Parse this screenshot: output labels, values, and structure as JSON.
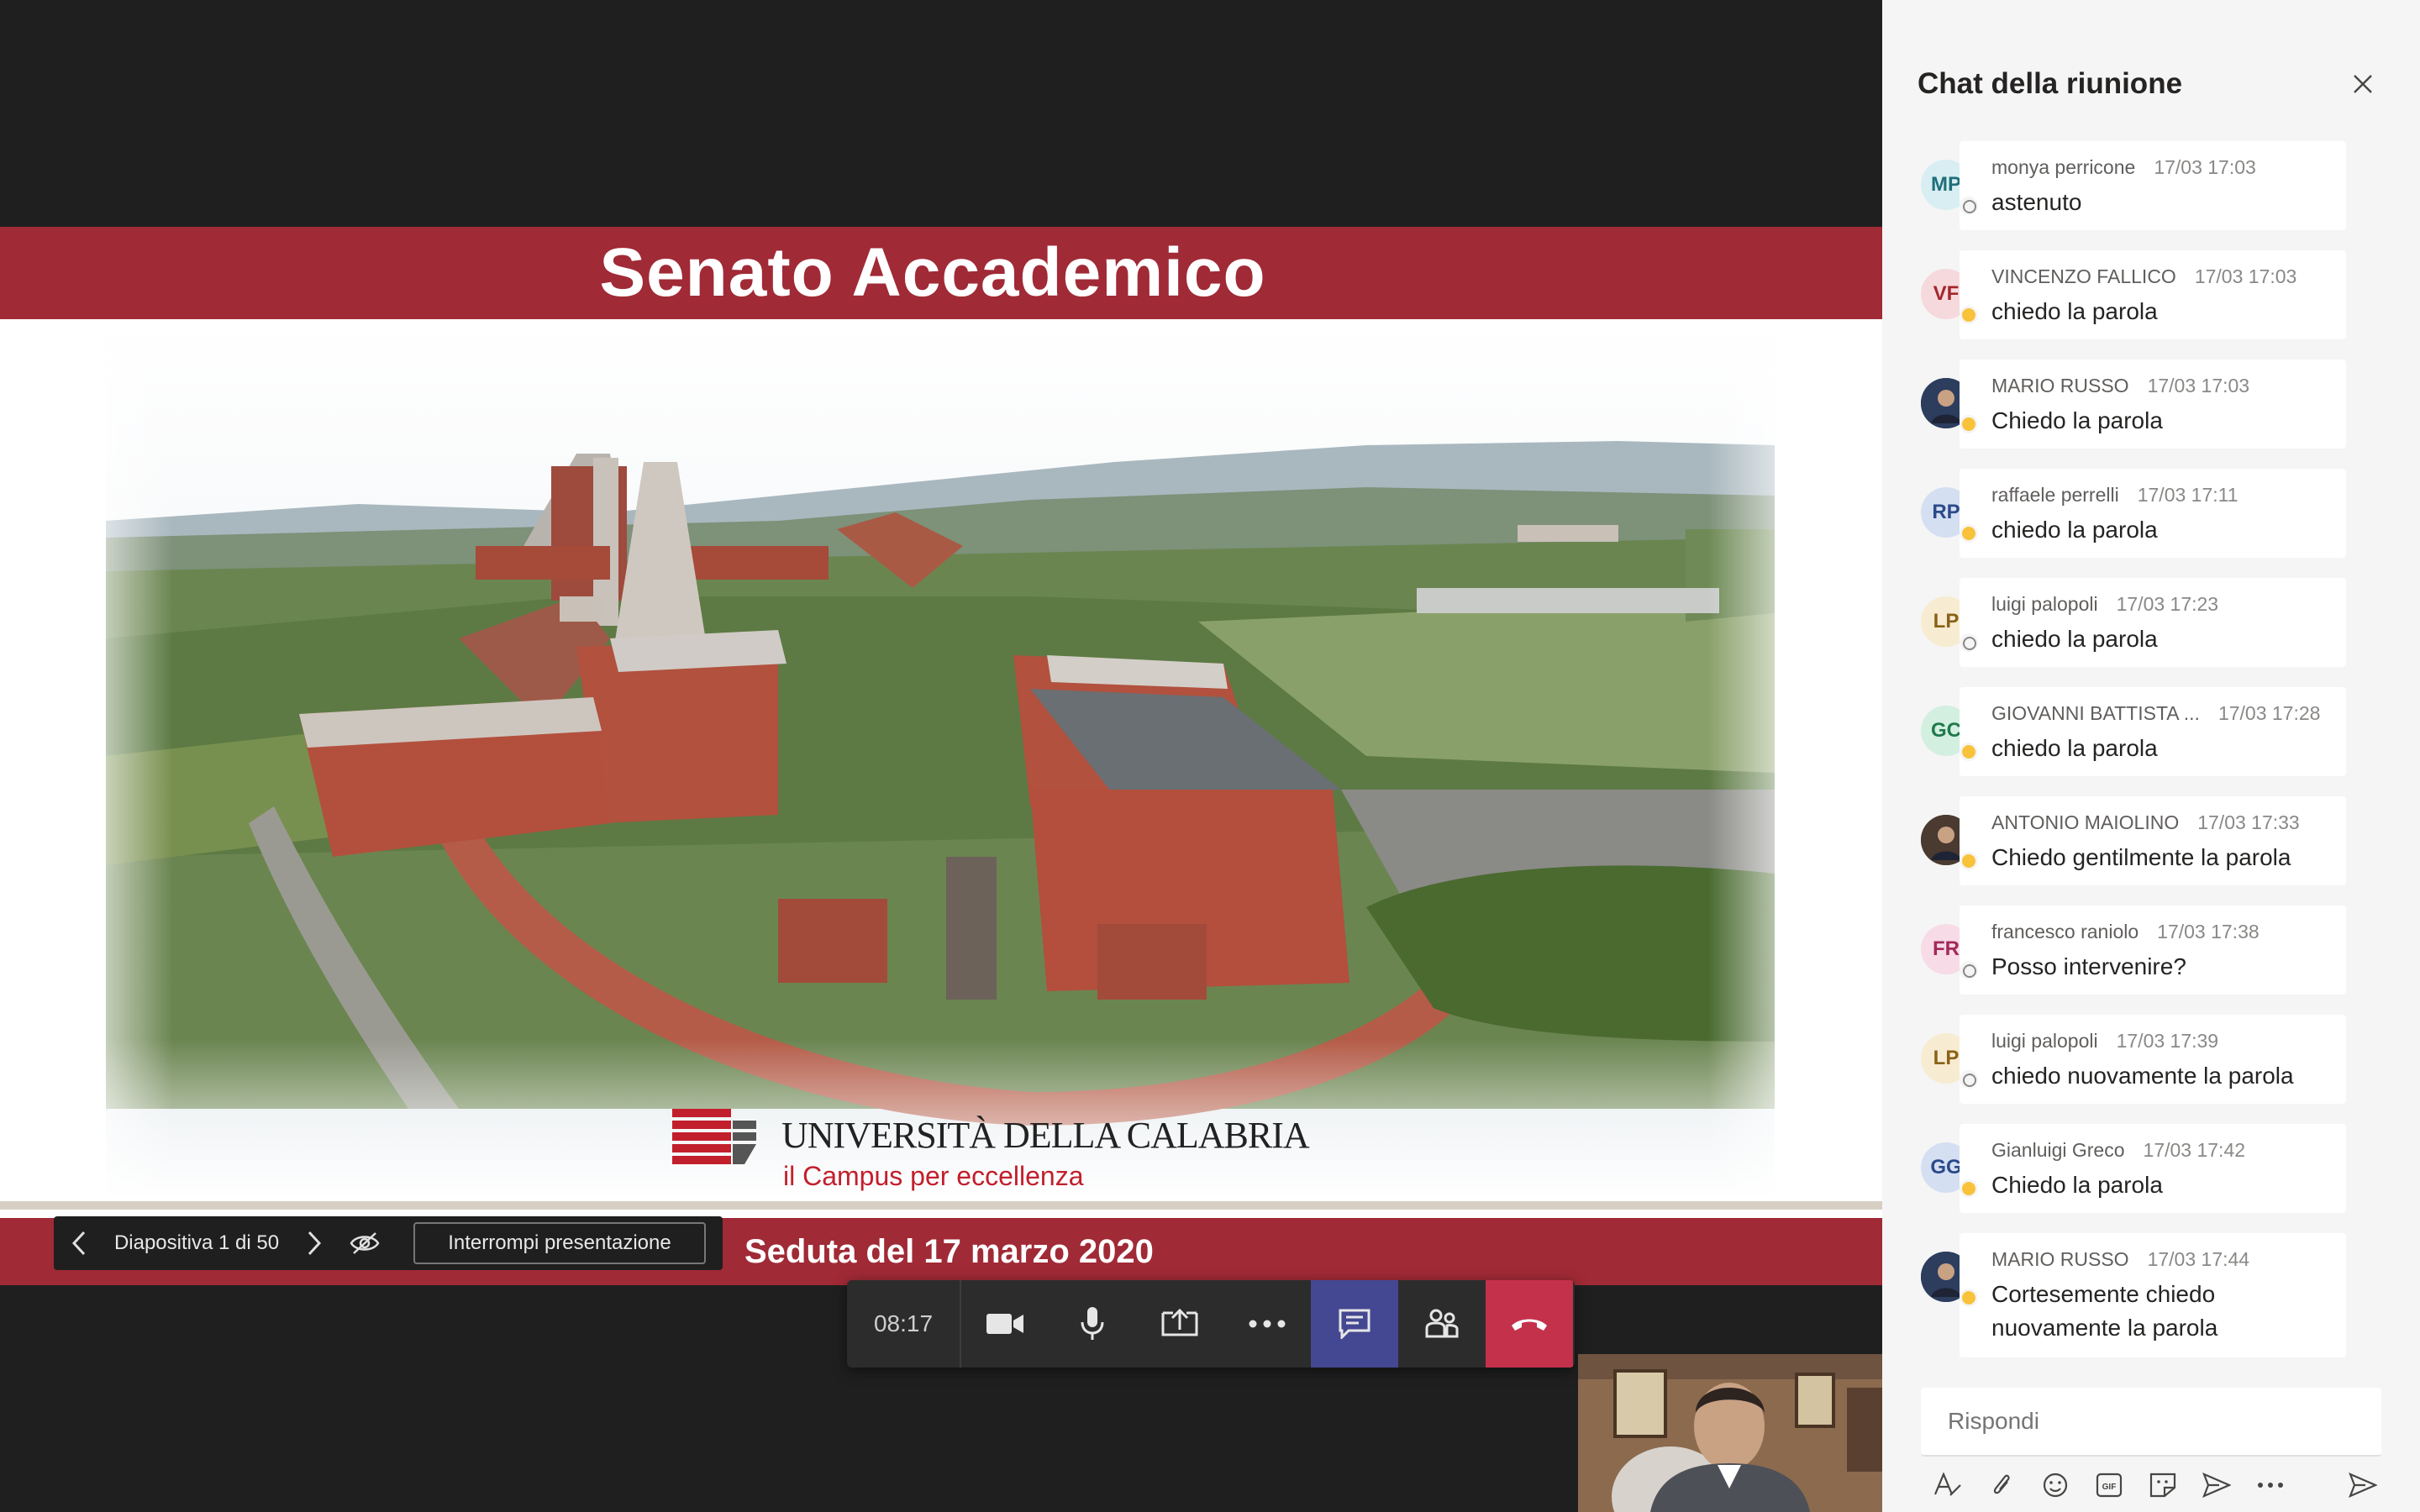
{
  "slide": {
    "title": "Senato Accademico",
    "logo_name": "UNIVERSITÀ DELLA CALABRIA",
    "logo_tagline": "il Campus per eccellenza",
    "subtitle": "Seduta del 17 marzo 2020"
  },
  "presenter_controls": {
    "slide_counter": "Diapositiva 1 di 50",
    "stop_label": "Interrompi presentazione"
  },
  "toolbar": {
    "timer": "08:17"
  },
  "chat": {
    "title": "Chat della riunione",
    "messages": [
      {
        "initials": "MP",
        "author": "monya perricone",
        "time": "17/03 17:03",
        "text": "astenuto",
        "avatar_bg": "#d8eef2",
        "avatar_fg": "#1e6e7a",
        "presence": "offline"
      },
      {
        "initials": "VF",
        "author": "VINCENZO FALLICO",
        "time": "17/03 17:03",
        "text": "chiedo la parola",
        "avatar_bg": "#f6d9dc",
        "avatar_fg": "#a4262c",
        "presence": "away"
      },
      {
        "initials": "",
        "author": "MARIO RUSSO",
        "time": "17/03 17:03",
        "text": "Chiedo la parola",
        "avatar_bg": "#2c3d5e",
        "avatar_fg": "#ffffff",
        "presence": "away"
      },
      {
        "initials": "RP",
        "author": "raffaele perrelli",
        "time": "17/03 17:11",
        "text": "chiedo la parola",
        "avatar_bg": "#d5dff2",
        "avatar_fg": "#2a4a8a",
        "presence": "away"
      },
      {
        "initials": "LP",
        "author": "luigi palopoli",
        "time": "17/03 17:23",
        "text": "chiedo la parola",
        "avatar_bg": "#f7ecd2",
        "avatar_fg": "#8a6116",
        "presence": "offline"
      },
      {
        "initials": "GC",
        "author": "GIOVANNI BATTISTA ...",
        "time": "17/03 17:28",
        "text": "chiedo la parola",
        "avatar_bg": "#d3efe0",
        "avatar_fg": "#1f7a4b",
        "presence": "away"
      },
      {
        "initials": "",
        "author": "ANTONIO MAIOLINO",
        "time": "17/03 17:33",
        "text": "Chiedo gentilmente la parola",
        "avatar_bg": "#4a3a30",
        "avatar_fg": "#ffffff",
        "presence": "away"
      },
      {
        "initials": "FR",
        "author": "francesco raniolo",
        "time": "17/03 17:38",
        "text": "Posso intervenire?",
        "avatar_bg": "#f7dbe6",
        "avatar_fg": "#a3285a",
        "presence": "offline"
      },
      {
        "initials": "LP",
        "author": "luigi palopoli",
        "time": "17/03 17:39",
        "text": "chiedo nuovamente la parola",
        "avatar_bg": "#f7ecd2",
        "avatar_fg": "#8a6116",
        "presence": "offline"
      },
      {
        "initials": "GG",
        "author": "Gianluigi Greco",
        "time": "17/03 17:42",
        "text": "Chiedo la parola",
        "avatar_bg": "#d5dff2",
        "avatar_fg": "#2a4a8a",
        "presence": "away"
      },
      {
        "initials": "",
        "author": "MARIO RUSSO",
        "time": "17/03 17:44",
        "text": "Cortesemente chiedo nuovamente la parola",
        "avatar_bg": "#2c3d5e",
        "avatar_fg": "#ffffff",
        "presence": "away"
      }
    ],
    "reply_placeholder": "Rispondi"
  },
  "colors": {
    "slide_red": "#a02a36",
    "teams_purple": "#444791",
    "hangup_red": "#c4314b"
  }
}
